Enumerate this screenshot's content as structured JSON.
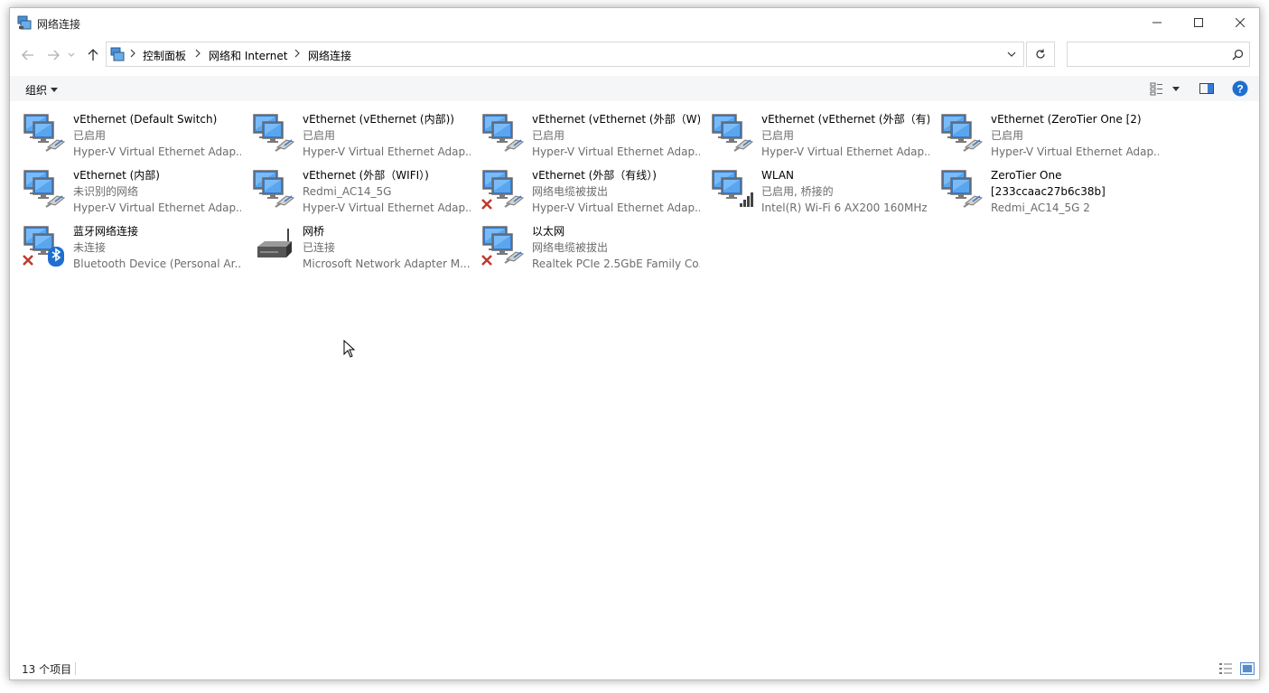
{
  "window": {
    "title": "网络连接"
  },
  "address_bar": {
    "crumbs": [
      "控制面板",
      "网络和 Internet",
      "网络连接"
    ],
    "search_placeholder": ""
  },
  "command_bar": {
    "organize_label": "组织"
  },
  "items": [
    {
      "name": "vEthernet (Default Switch)",
      "status": "已启用",
      "device": "Hyper-V Virtual Ethernet Adap...",
      "icon": "network-adapter-icon",
      "disconnected": false
    },
    {
      "name": "vEthernet (vEthernet (内部))",
      "status": "已启用",
      "device": "Hyper-V Virtual Ethernet Adap...",
      "icon": "network-adapter-icon",
      "disconnected": false
    },
    {
      "name": "vEthernet (vEthernet (外部（W)",
      "status": "已启用",
      "device": "Hyper-V Virtual Ethernet Adap...",
      "icon": "network-adapter-icon",
      "disconnected": false
    },
    {
      "name": "vEthernet (vEthernet (外部（有)",
      "status": "已启用",
      "device": "Hyper-V Virtual Ethernet Adap...",
      "icon": "network-adapter-icon",
      "disconnected": false
    },
    {
      "name": "vEthernet (ZeroTier One [2)",
      "status": "已启用",
      "device": "Hyper-V Virtual Ethernet Adap...",
      "icon": "network-adapter-icon",
      "disconnected": false
    },
    {
      "name": "vEthernet (内部)",
      "status": "未识别的网络",
      "device": "Hyper-V Virtual Ethernet Adap...",
      "icon": "network-adapter-icon",
      "disconnected": false
    },
    {
      "name": "vEthernet (外部（WIFI）)",
      "status": "Redmi_AC14_5G",
      "device": "Hyper-V Virtual Ethernet Adap...",
      "icon": "network-adapter-icon",
      "disconnected": false
    },
    {
      "name": "vEthernet (外部（有线）)",
      "status": "网络电缆被拔出",
      "device": "Hyper-V Virtual Ethernet Adap...",
      "icon": "network-adapter-icon",
      "disconnected": true
    },
    {
      "name": "WLAN",
      "status": "已启用, 桥接的",
      "device": "Intel(R) Wi-Fi 6 AX200 160MHz",
      "icon": "wlan-adapter-icon",
      "disconnected": false
    },
    {
      "name": "ZeroTier One",
      "status": "[233ccaac27b6c38b]",
      "device": "Redmi_AC14_5G 2",
      "icon": "network-adapter-icon",
      "disconnected": false,
      "name_is_dark_line2": true
    },
    {
      "name": "蓝牙网络连接",
      "status": "未连接",
      "device": "Bluetooth Device (Personal Ar...",
      "icon": "bluetooth-adapter-icon",
      "disconnected": true
    },
    {
      "name": "网桥",
      "status": "已连接",
      "device": "Microsoft Network Adapter M...",
      "icon": "network-bridge-icon",
      "disconnected": false
    },
    {
      "name": "以太网",
      "status": "网络电缆被拔出",
      "device": "Realtek PCIe 2.5GbE Family Co...",
      "icon": "network-adapter-icon",
      "disconnected": true
    }
  ],
  "status_bar": {
    "item_count": "13 个项目"
  },
  "colors": {
    "accent": "#0a64c8",
    "help": "#1e6fd0",
    "error_x": "#c0392b"
  }
}
